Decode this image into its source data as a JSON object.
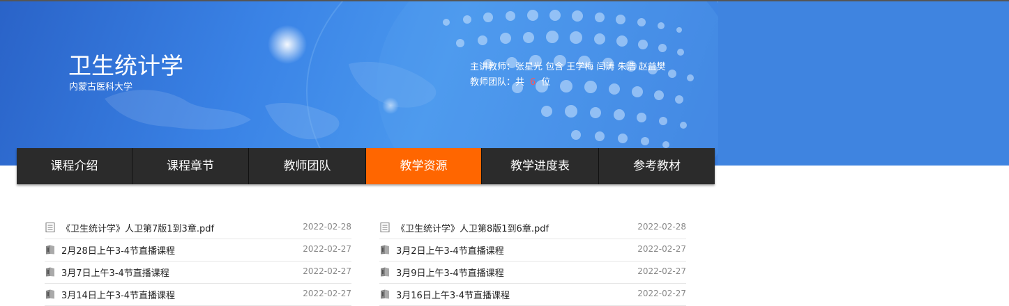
{
  "course": {
    "title": "卫生统计学",
    "school": "内蒙古医科大学",
    "lead_teachers_label": "主讲教师：",
    "lead_teachers": "张星光 包含 王学梅 闫涛 朱浩 赵益樊",
    "team_label": "教师团队：共",
    "team_count": "6",
    "team_unit": "位"
  },
  "nav": {
    "items": [
      {
        "label": "课程介绍"
      },
      {
        "label": "课程章节"
      },
      {
        "label": "教师团队"
      },
      {
        "label": "教学资源"
      },
      {
        "label": "教学进度表"
      },
      {
        "label": "参考教材"
      }
    ],
    "active": "教学资源"
  },
  "resources": {
    "left": [
      {
        "name": "《卫生统计学》人卫第7版1到3章.pdf",
        "date": "2022-02-28",
        "icon": "document-icon"
      },
      {
        "name": "2月28日上午3-4节直播课程",
        "date": "2022-02-27",
        "icon": "book-icon"
      },
      {
        "name": "3月7日上午3-4节直播课程",
        "date": "2022-02-27",
        "icon": "book-icon"
      },
      {
        "name": "3月14日上午3-4节直播课程",
        "date": "2022-02-27",
        "icon": "book-icon"
      }
    ],
    "right": [
      {
        "name": "《卫生统计学》人卫第8版1到6章.pdf",
        "date": "2022-02-28",
        "icon": "document-icon"
      },
      {
        "name": "3月2日上午3-4节直播课程",
        "date": "2022-02-27",
        "icon": "book-icon"
      },
      {
        "name": "3月9日上午3-4节直播课程",
        "date": "2022-02-27",
        "icon": "book-icon"
      },
      {
        "name": "3月16日上午3-4节直播课程",
        "date": "2022-02-27",
        "icon": "book-icon"
      }
    ]
  },
  "colors": {
    "banner": "#3f84e0",
    "nav_bg": "#2b2b2b",
    "nav_active": "#ff6600",
    "team_count": "#ff5555"
  }
}
